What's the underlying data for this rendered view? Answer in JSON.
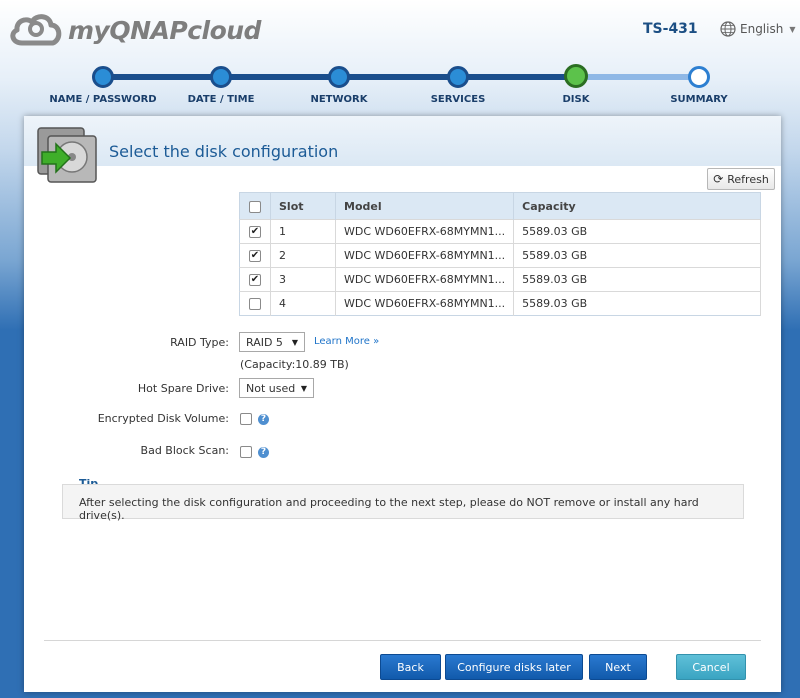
{
  "header": {
    "logo_text": "myQNAPcloud",
    "model": "TS-431",
    "language": "English"
  },
  "steps": [
    {
      "label": "NAME / PASSWORD",
      "state": "done"
    },
    {
      "label": "DATE / TIME",
      "state": "done"
    },
    {
      "label": "NETWORK",
      "state": "done"
    },
    {
      "label": "SERVICES",
      "state": "done"
    },
    {
      "label": "DISK",
      "state": "current"
    },
    {
      "label": "SUMMARY",
      "state": "pending"
    }
  ],
  "page": {
    "title": "Select the disk configuration",
    "refresh_label": "Refresh"
  },
  "table": {
    "headers": {
      "slot": "Slot",
      "model": "Model",
      "capacity": "Capacity"
    },
    "rows": [
      {
        "checked": true,
        "slot": "1",
        "model": "WDC WD60EFRX-68MYMN1...",
        "capacity": "5589.03 GB"
      },
      {
        "checked": true,
        "slot": "2",
        "model": "WDC WD60EFRX-68MYMN1...",
        "capacity": "5589.03 GB"
      },
      {
        "checked": true,
        "slot": "3",
        "model": "WDC WD60EFRX-68MYMN1...",
        "capacity": "5589.03 GB"
      },
      {
        "checked": false,
        "slot": "4",
        "model": "WDC WD60EFRX-68MYMN1...",
        "capacity": "5589.03 GB"
      }
    ]
  },
  "form": {
    "raid_type_label": "RAID Type:",
    "raid_type_value": "RAID 5",
    "learn_more": "Learn More »",
    "capacity_note": "(Capacity:10.89 TB)",
    "hot_spare_label": "Hot Spare Drive:",
    "hot_spare_value": "Not used",
    "encrypted_label": "Encrypted Disk Volume:",
    "bad_block_label": "Bad Block Scan:"
  },
  "tip": {
    "title": "Tip",
    "text": "After selecting the disk configuration and proceeding to the next step, please do NOT remove or install any hard drive(s)."
  },
  "buttons": {
    "back": "Back",
    "configure_later": "Configure disks later",
    "next": "Next",
    "cancel": "Cancel"
  },
  "colors": {
    "accent": "#1c5b96",
    "progress_done": "#1a4e8c",
    "progress_current": "#5cc24b",
    "button_blue": "#115aab",
    "button_teal": "#3aa4c2"
  }
}
